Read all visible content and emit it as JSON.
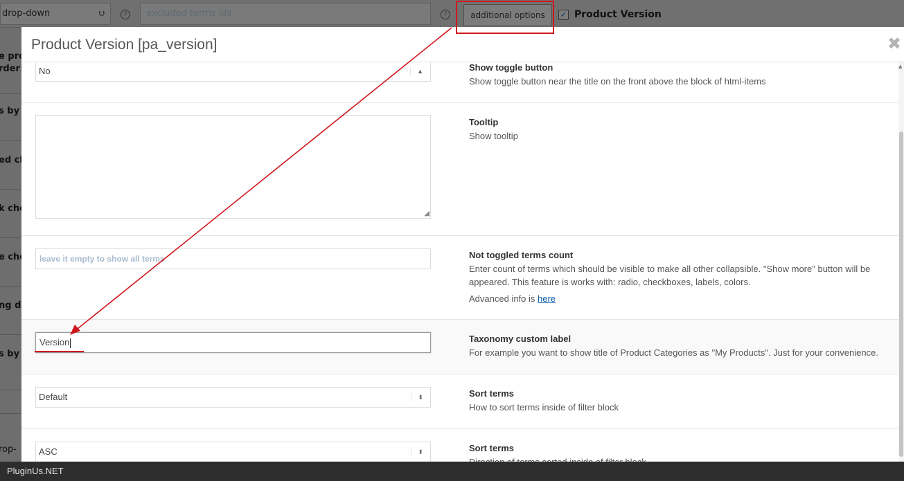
{
  "background": {
    "display_select": "drop-down",
    "excluded_placeholder": "excluded terms ids",
    "additional_options_label": "additional options",
    "product_version_checkbox": "Product Version",
    "help_glyph": "?",
    "row_labels": [
      "e pro",
      "rder:",
      "s by A",
      "ed ch",
      "k che",
      "e che",
      "ng dr",
      "s by S",
      "rop-"
    ]
  },
  "modal": {
    "title": "Product Version [pa_version]",
    "close_glyph": "✖"
  },
  "options": [
    {
      "id": "show_toggle",
      "control": "select",
      "value": "No",
      "title": "Show toggle button",
      "desc": "Show toggle button near the title on the front above the block of html-items"
    },
    {
      "id": "tooltip",
      "control": "textarea",
      "value": "",
      "title": "Tooltip",
      "desc": "Show tooltip"
    },
    {
      "id": "not_toggled_count",
      "control": "input",
      "placeholder": "leave it empty to show all terms",
      "title": "Not toggled terms count",
      "desc": "Enter count of terms which should be visible to make all other collapsible. \"Show more\" button will be appeared. This feature is works with: radio, checkboxes, labels, colors.",
      "extra_prefix": "Advanced info is ",
      "extra_link": "here"
    },
    {
      "id": "custom_label",
      "control": "input",
      "value": "Version",
      "title": "Taxonomy custom label",
      "desc": "For example you want to show title of Product Categories as \"My Products\". Just for your convenience."
    },
    {
      "id": "sort_terms",
      "control": "select",
      "value": "Default",
      "title": "Sort terms",
      "desc": "How to sort terms inside of filter block"
    },
    {
      "id": "sort_direction",
      "control": "select",
      "value": "ASC",
      "title": "Sort terms",
      "desc": "Direction of terms sorted inside of filter block"
    }
  ],
  "annotation": {
    "color": "#d0161c"
  },
  "footer": {
    "brand": "PluginUs.NET"
  }
}
